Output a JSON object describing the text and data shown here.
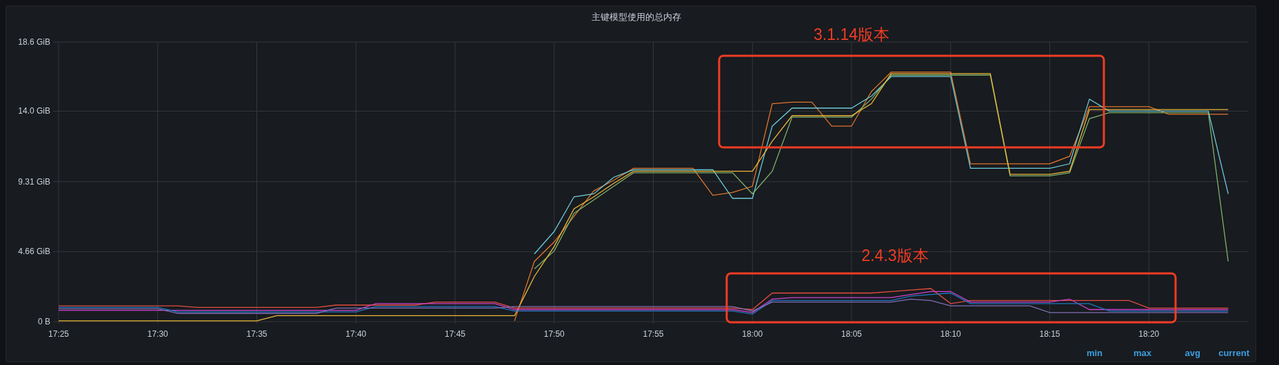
{
  "panel": {
    "title": "主键模型使用的总内存",
    "chart_data": {
      "type": "line",
      "categories": [
        "17:25",
        null,
        null,
        null,
        null,
        "17:30",
        null,
        null,
        null,
        null,
        "17:35",
        null,
        null,
        null,
        null,
        "17:40",
        null,
        null,
        null,
        null,
        "17:45",
        null,
        null,
        null,
        null,
        "17:50",
        null,
        null,
        null,
        null,
        "17:55",
        null,
        null,
        null,
        null,
        "18:00",
        null,
        null,
        null,
        null,
        "18:05",
        null,
        null,
        null,
        null,
        "18:10",
        null,
        null,
        null,
        null,
        "18:15",
        null,
        null,
        null,
        null,
        "18:20",
        null,
        null,
        null,
        null
      ],
      "ylim": [
        0,
        18.6
      ],
      "grid": true,
      "yticks": [
        {
          "value": 0,
          "label": "0 B"
        },
        {
          "value": 4.66,
          "label": "4.66 GiB"
        },
        {
          "value": 9.31,
          "label": "9.31 GiB"
        },
        {
          "value": 14.0,
          "label": "14.0 GiB"
        },
        {
          "value": 18.6,
          "label": "18.6 GiB"
        }
      ],
      "series": [
        {
          "color": "#e0752d",
          "values": [
            null,
            null,
            null,
            null,
            null,
            null,
            null,
            null,
            null,
            null,
            null,
            null,
            null,
            null,
            null,
            null,
            null,
            null,
            null,
            null,
            null,
            null,
            null,
            0.05,
            4.0,
            5.3,
            7.0,
            8.7,
            9.4,
            10.2,
            10.2,
            10.2,
            10.2,
            8.4,
            8.6,
            9.0,
            14.5,
            14.6,
            14.6,
            13.0,
            13.0,
            15.3,
            16.6,
            16.6,
            16.6,
            16.6,
            10.5,
            10.5,
            10.5,
            10.5,
            10.5,
            11.0,
            14.3,
            14.3,
            14.3,
            14.3,
            13.8,
            13.8,
            13.8,
            13.8
          ]
        },
        {
          "color": "#6ccbd9",
          "values": [
            null,
            null,
            null,
            null,
            null,
            null,
            null,
            null,
            null,
            null,
            null,
            null,
            null,
            null,
            null,
            null,
            null,
            null,
            null,
            null,
            null,
            null,
            null,
            null,
            4.5,
            6.0,
            8.3,
            8.5,
            9.6,
            10.1,
            10.1,
            10.1,
            10.1,
            10.1,
            8.2,
            8.2,
            13.0,
            14.2,
            14.2,
            14.2,
            14.2,
            15.0,
            16.3,
            16.3,
            16.3,
            16.3,
            10.2,
            10.2,
            10.2,
            10.2,
            10.2,
            10.5,
            14.8,
            14.0,
            14.0,
            14.0,
            14.0,
            14.0,
            14.0,
            8.5
          ]
        },
        {
          "color": "#7eb26d",
          "values": [
            null,
            null,
            null,
            null,
            null,
            null,
            null,
            null,
            null,
            null,
            null,
            null,
            null,
            null,
            null,
            null,
            null,
            null,
            null,
            null,
            null,
            null,
            null,
            null,
            3.5,
            4.7,
            7.2,
            8.1,
            9.0,
            9.9,
            9.9,
            9.9,
            9.9,
            9.9,
            9.9,
            8.5,
            10.0,
            13.6,
            13.6,
            13.6,
            13.6,
            14.8,
            16.4,
            16.4,
            16.4,
            16.4,
            16.4,
            16.4,
            9.7,
            9.7,
            9.7,
            9.9,
            13.5,
            13.9,
            13.9,
            13.9,
            13.9,
            13.9,
            13.9,
            4.0
          ]
        },
        {
          "color": "#eab839",
          "values": [
            0.05,
            0.05,
            0.05,
            0.05,
            0.05,
            0.05,
            0.05,
            0.05,
            0.05,
            0.05,
            0.05,
            0.4,
            0.4,
            0.4,
            0.4,
            0.4,
            0.4,
            0.4,
            0.4,
            0.4,
            0.4,
            0.4,
            0.4,
            0.4,
            3.0,
            5.0,
            7.5,
            8.3,
            9.2,
            10.0,
            10.0,
            10.0,
            10.0,
            10.0,
            10.0,
            10.0,
            12.0,
            13.7,
            13.7,
            13.7,
            13.7,
            14.5,
            16.5,
            16.5,
            16.5,
            16.5,
            16.5,
            16.5,
            9.8,
            9.8,
            9.8,
            10.0,
            14.1,
            14.1,
            14.1,
            14.1,
            14.1,
            14.1,
            14.1,
            14.1
          ]
        },
        {
          "color": "#e24d42",
          "values": [
            1.05,
            1.05,
            1.05,
            1.05,
            1.05,
            1.05,
            1.05,
            0.95,
            0.95,
            0.95,
            0.95,
            0.95,
            0.95,
            0.95,
            1.1,
            1.1,
            1.1,
            1.1,
            1.1,
            1.3,
            1.3,
            1.3,
            1.3,
            0.9,
            0.9,
            0.9,
            0.9,
            0.9,
            0.9,
            0.9,
            0.9,
            0.9,
            0.9,
            0.9,
            0.9,
            0.8,
            1.9,
            1.9,
            1.9,
            1.9,
            1.9,
            1.9,
            2.0,
            2.1,
            2.2,
            1.2,
            1.4,
            1.4,
            1.4,
            1.4,
            1.4,
            1.4,
            1.4,
            1.4,
            1.4,
            0.9,
            0.9,
            0.9,
            0.9,
            0.9
          ]
        },
        {
          "color": "#d044d0",
          "values": [
            0.75,
            0.75,
            0.75,
            0.75,
            0.75,
            0.75,
            0.75,
            0.75,
            0.75,
            0.75,
            0.75,
            0.75,
            0.75,
            0.75,
            0.75,
            0.75,
            1.2,
            1.2,
            1.2,
            1.2,
            1.2,
            1.2,
            1.2,
            0.8,
            0.8,
            0.8,
            0.8,
            0.8,
            0.8,
            0.8,
            0.8,
            0.8,
            0.8,
            0.8,
            0.8,
            0.6,
            1.5,
            1.6,
            1.6,
            1.6,
            1.6,
            1.6,
            1.6,
            1.8,
            2.0,
            2.0,
            1.3,
            1.3,
            1.3,
            1.3,
            1.3,
            1.5,
            0.8,
            0.8,
            0.8,
            0.8,
            0.8,
            0.8,
            0.8,
            0.8
          ]
        },
        {
          "color": "#1f78c1",
          "values": [
            0.95,
            0.95,
            0.95,
            0.95,
            0.95,
            0.95,
            0.65,
            0.65,
            0.65,
            0.65,
            0.65,
            0.65,
            0.65,
            0.65,
            0.65,
            0.65,
            1.0,
            1.0,
            1.0,
            1.0,
            1.0,
            1.0,
            1.0,
            0.7,
            0.7,
            0.7,
            0.7,
            0.7,
            0.7,
            0.7,
            0.7,
            0.7,
            0.7,
            0.7,
            0.7,
            0.5,
            1.4,
            1.4,
            1.4,
            1.4,
            1.4,
            1.4,
            1.4,
            1.7,
            1.8,
            1.9,
            1.2,
            1.2,
            1.2,
            1.2,
            1.2,
            1.2,
            1.2,
            0.7,
            0.7,
            0.7,
            0.7,
            0.7,
            0.7,
            0.7
          ]
        },
        {
          "color": "#806eb7",
          "values": [
            0.85,
            0.85,
            0.85,
            0.85,
            0.85,
            0.85,
            0.55,
            0.55,
            0.55,
            0.55,
            0.55,
            0.55,
            0.55,
            0.55,
            0.9,
            0.9,
            0.9,
            0.9,
            0.9,
            0.9,
            0.9,
            0.9,
            0.9,
            1.0,
            1.0,
            1.0,
            1.0,
            1.0,
            1.0,
            1.0,
            1.0,
            1.0,
            1.0,
            1.0,
            1.0,
            0.7,
            1.3,
            1.3,
            1.3,
            1.3,
            1.3,
            1.3,
            1.3,
            1.5,
            1.4,
            1.05,
            1.05,
            1.05,
            1.05,
            1.05,
            0.6,
            0.6,
            0.6,
            0.6,
            0.6,
            0.6,
            0.6,
            0.6,
            0.6,
            0.6
          ]
        }
      ],
      "annotations": [
        {
          "text": "3.1.14版本"
        },
        {
          "text": "2.4.3版本"
        }
      ]
    },
    "legend": {
      "columns": [
        "min",
        "max",
        "avg",
        "current"
      ]
    }
  }
}
